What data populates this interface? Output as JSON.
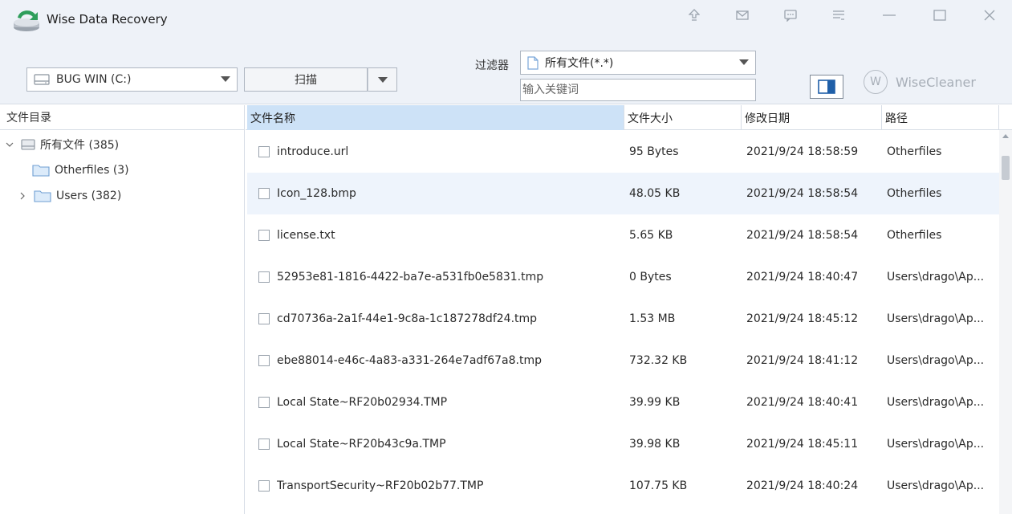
{
  "app": {
    "title": "Wise Data Recovery",
    "accent_color": "#2e9e5b"
  },
  "titlebar_icons": [
    "upgrade-icon",
    "mail-icon",
    "feedback-icon",
    "menu-icon",
    "minimize-icon",
    "maximize-icon",
    "close-icon"
  ],
  "toolbar": {
    "drive_label": "BUG WIN (C:)",
    "scan_label": "扫描",
    "filter_label": "过滤器",
    "filter_value": "所有文件(*.*)",
    "keyword_placeholder": "输入关键词",
    "brand": "WiseCleaner",
    "brand_logo_letter": "W"
  },
  "tree": {
    "header": "文件目录",
    "nodes": [
      {
        "label": "所有文件 (385)",
        "type": "drive",
        "expanded": true
      },
      {
        "label": "Otherfiles (3)",
        "type": "folder"
      },
      {
        "label": "Users (382)",
        "type": "folder",
        "expanded": false
      }
    ]
  },
  "list": {
    "columns": [
      "文件名称",
      "文件大小",
      "修改日期",
      "路径"
    ],
    "rows": [
      {
        "name": "introduce.url",
        "size": "95 Bytes",
        "date": "2021/9/24 18:58:59",
        "path": "Otherfiles"
      },
      {
        "name": "Icon_128.bmp",
        "size": "48.05 KB",
        "date": "2021/9/24 18:58:54",
        "path": "Otherfiles"
      },
      {
        "name": "license.txt",
        "size": "5.65 KB",
        "date": "2021/9/24 18:58:54",
        "path": "Otherfiles"
      },
      {
        "name": "52953e81-1816-4422-ba7e-a531fb0e5831.tmp",
        "size": "0 Bytes",
        "date": "2021/9/24 18:40:47",
        "path": "Users\\drago\\Ap..."
      },
      {
        "name": "cd70736a-2a1f-44e1-9c8a-1c187278df24.tmp",
        "size": "1.53 MB",
        "date": "2021/9/24 18:45:12",
        "path": "Users\\drago\\Ap..."
      },
      {
        "name": "ebe88014-e46c-4a83-a331-264e7adf67a8.tmp",
        "size": "732.32 KB",
        "date": "2021/9/24 18:41:12",
        "path": "Users\\drago\\Ap..."
      },
      {
        "name": "Local State~RF20b02934.TMP",
        "size": "39.99 KB",
        "date": "2021/9/24 18:40:41",
        "path": "Users\\drago\\Ap..."
      },
      {
        "name": "Local State~RF20b43c9a.TMP",
        "size": "39.98 KB",
        "date": "2021/9/24 18:45:11",
        "path": "Users\\drago\\Ap..."
      },
      {
        "name": "TransportSecurity~RF20b02b77.TMP",
        "size": "107.75 KB",
        "date": "2021/9/24 18:40:24",
        "path": "Users\\drago\\Ap..."
      }
    ]
  }
}
